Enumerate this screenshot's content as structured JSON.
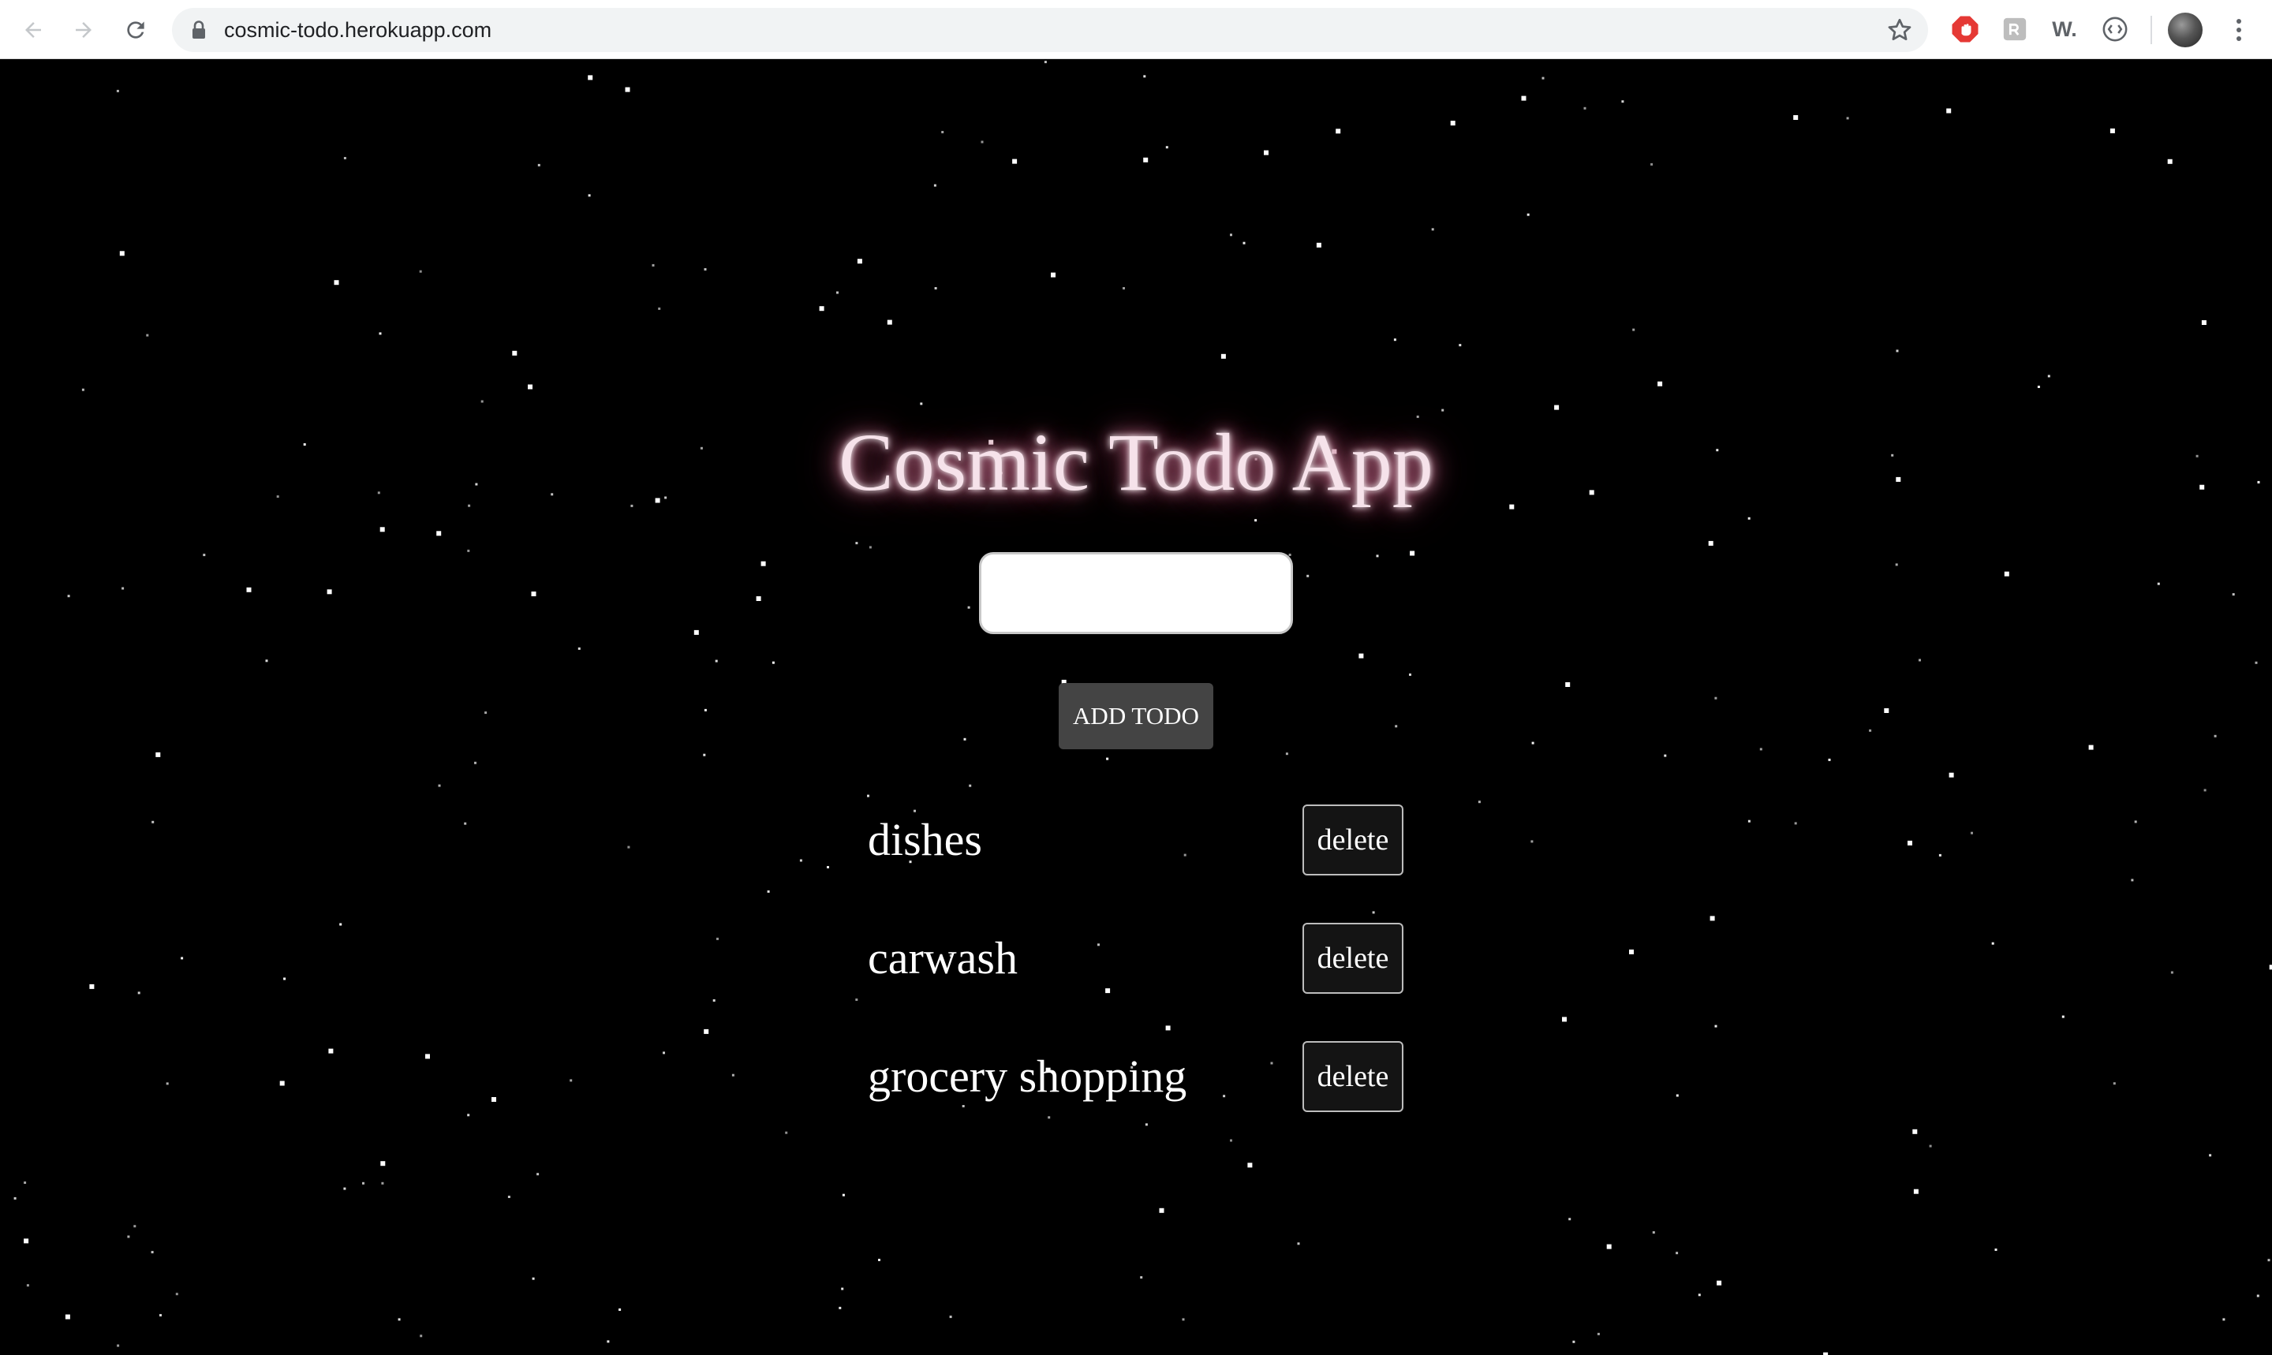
{
  "browser": {
    "url": "cosmic-todo.herokuapp.com",
    "extensions": [
      "adblock-icon",
      "extension-icon",
      "w-extension-icon",
      "code-extension-icon"
    ],
    "w_extension_label": "W.",
    "colors": {
      "adblock": "#e53935",
      "toolbar_icon": "#5f6368",
      "omnibox": "#f1f3f4"
    }
  },
  "app": {
    "title": "Cosmic Todo App",
    "input": {
      "value": "",
      "placeholder": ""
    },
    "add_button_label": "ADD TODO",
    "todos": [
      {
        "text": "dishes",
        "delete_label": "delete"
      },
      {
        "text": "carwash",
        "delete_label": "delete"
      },
      {
        "text": "grocery shopping",
        "delete_label": "delete"
      }
    ],
    "colors": {
      "background": "#000000",
      "title_glow": "#b0506e",
      "add_button": "#444444",
      "delete_button": "#141414"
    }
  }
}
